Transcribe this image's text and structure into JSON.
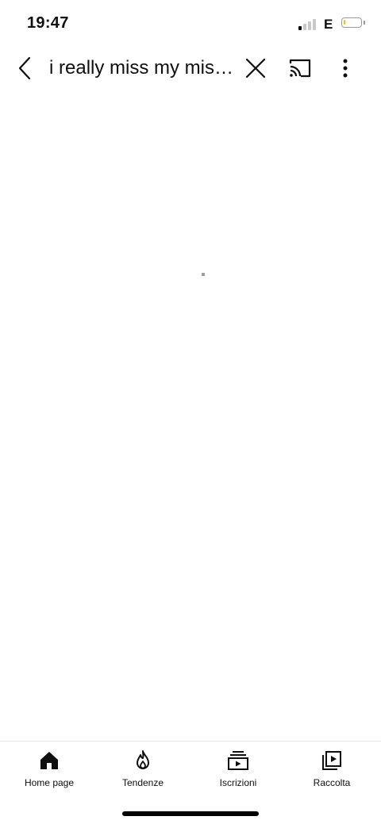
{
  "status_bar": {
    "time": "19:47",
    "network": "E",
    "signal_bars_active": 1,
    "battery_level_fraction": 0.1,
    "battery_color": "#f5c400"
  },
  "header": {
    "search_query": "i really miss my mis…",
    "back_icon": "chevron-left-icon",
    "clear_icon": "close-icon",
    "cast_icon": "cast-icon",
    "more_icon": "more-vertical-icon"
  },
  "content": {
    "state": "loading"
  },
  "bottom_nav": {
    "items": [
      {
        "label": "Home page",
        "icon": "home-icon",
        "selected": true
      },
      {
        "label": "Tendenze",
        "icon": "flame-icon",
        "selected": false
      },
      {
        "label": "Iscrizioni",
        "icon": "subscriptions-icon",
        "selected": false
      },
      {
        "label": "Raccolta",
        "icon": "library-icon",
        "selected": false
      }
    ]
  }
}
